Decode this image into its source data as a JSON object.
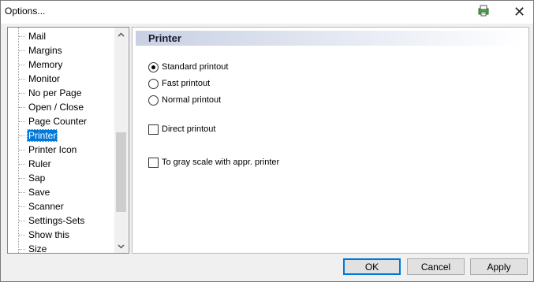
{
  "window": {
    "title": "Options..."
  },
  "tree": {
    "items": [
      {
        "label": "Mail"
      },
      {
        "label": "Margins"
      },
      {
        "label": "Memory"
      },
      {
        "label": "Monitor"
      },
      {
        "label": "No per Page"
      },
      {
        "label": "Open / Close"
      },
      {
        "label": "Page Counter"
      },
      {
        "label": "Printer",
        "selected": true
      },
      {
        "label": "Printer Icon"
      },
      {
        "label": "Ruler"
      },
      {
        "label": "Sap"
      },
      {
        "label": "Save"
      },
      {
        "label": "Scanner"
      },
      {
        "label": "Settings-Sets"
      },
      {
        "label": "Show this"
      },
      {
        "label": "Size"
      }
    ]
  },
  "panel": {
    "title": "Printer",
    "options": [
      {
        "type": "radio",
        "label": "Standard printout",
        "checked": true
      },
      {
        "type": "radio",
        "label": "Fast printout",
        "checked": false
      },
      {
        "type": "radio",
        "label": "Normal printout",
        "checked": false
      },
      {
        "type": "checkbox",
        "label": "Direct printout",
        "checked": false
      },
      {
        "type": "checkbox",
        "label": "To gray scale with appr. printer",
        "checked": false
      }
    ]
  },
  "buttons": {
    "ok": "OK",
    "cancel": "Cancel",
    "apply": "Apply"
  },
  "icons": {
    "app": "printer-app-icon",
    "close": "close-icon",
    "scroll_up": "chevron-up-icon",
    "scroll_down": "chevron-down-icon"
  },
  "colors": {
    "selection": "#0078d7",
    "header_gradient_start": "#c8d0e2"
  }
}
